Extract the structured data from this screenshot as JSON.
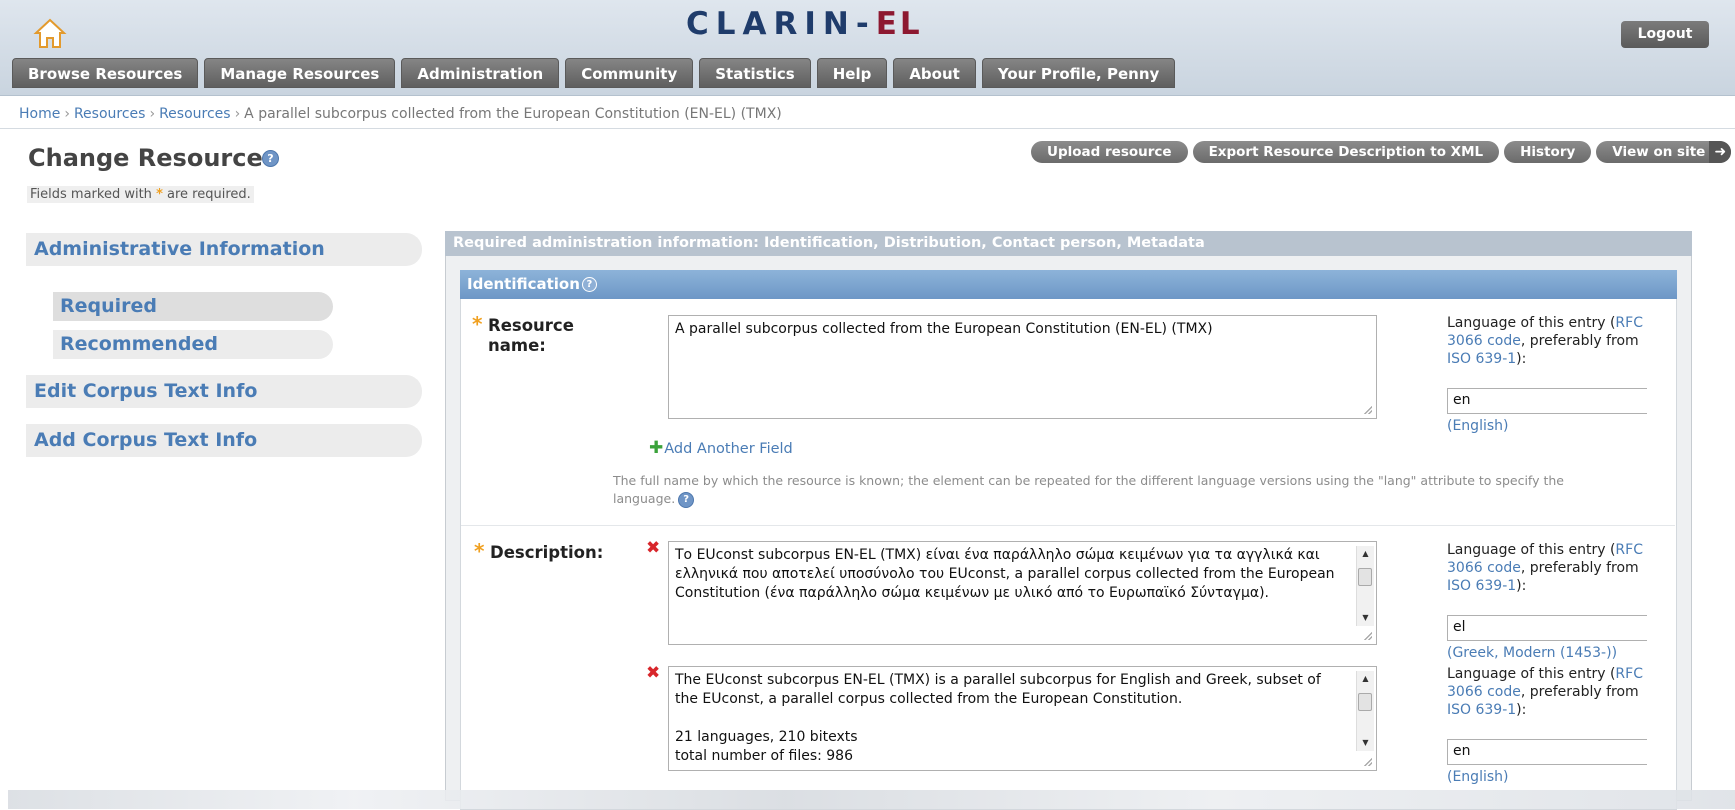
{
  "header": {
    "brand_main": "CLARIN-",
    "brand_suffix": "EL",
    "logout_label": "Logout",
    "nav_tabs": [
      "Browse Resources",
      "Manage Resources",
      "Administration",
      "Community",
      "Statistics",
      "Help",
      "About",
      "Your Profile, Penny"
    ]
  },
  "breadcrumb": {
    "items": [
      "Home",
      "Resources",
      "Resources"
    ],
    "current": "A parallel subcorpus collected from the European Constitution (EN-EL) (TMX)",
    "separator": "›"
  },
  "page": {
    "title": "Change Resource",
    "required_note_prefix": "Fields marked with",
    "required_note_suffix": "are required.",
    "required_star": "*"
  },
  "actions": [
    "Upload resource",
    "Export Resource Description to XML",
    "History",
    "View on site"
  ],
  "sidebar": {
    "administrative": "Administrative Information",
    "required": "Required",
    "recommended": "Recommended",
    "edit_corpus": "Edit Corpus Text Info",
    "add_corpus": "Add Corpus Text Info"
  },
  "panel": {
    "header": "Required administration information: Identification, Distribution, Contact person, Metadata",
    "section_title": "Identification"
  },
  "resource_name": {
    "label_line1": "Resource",
    "label_line2": "name:",
    "value": "A parallel subcorpus collected from the European Constitution (EN-EL) (TMX)",
    "lang": {
      "text_prefix": "Language of this entry (",
      "link1": "RFC 3066 code",
      "text_mid": ", preferably from ",
      "link2": "ISO 639-1",
      "text_suffix": "):",
      "code": "en",
      "name": "(English)"
    },
    "add_field": "Add Another Field",
    "hint": "The full name by which the resource is known; the element can be repeated for the different language versions using the \"lang\" attribute to specify the language."
  },
  "description": {
    "label": "Description:",
    "entries": [
      {
        "value": "Το EUconst subcorpus EN-EL (TMX) είναι ένα παράλληλο σώμα κειμένων για τα αγγλικά και ελληνικά που αποτελεί υποσύνολο του EUconst, a parallel corpus collected from the European Constitution (ένα παράλληλο σώμα κειμένων με υλικό από το Ευρωπαϊκό Σύνταγμα).",
        "lang_code": "el",
        "lang_name": "(Greek, Modern (1453-))"
      },
      {
        "value": "The EUconst subcorpus EN-EL (TMX) is a parallel subcorpus for English and Greek, subset of the EUconst, a parallel corpus collected from the European Constitution.\n\n21 languages, 210 bitexts\ntotal number of files: 986",
        "lang_code": "en",
        "lang_name": "(English)"
      }
    ]
  },
  "colors": {
    "brand_blue": "#1f3c6b",
    "brand_red": "#8d1830",
    "link": "#4a7cb5",
    "required_star": "#f0a020",
    "delete": "#d8262b"
  },
  "icons": {
    "home": "home-icon",
    "help": "help-icon",
    "delete": "delete-icon",
    "add": "plus-icon",
    "arrow": "arrow-right-icon"
  }
}
